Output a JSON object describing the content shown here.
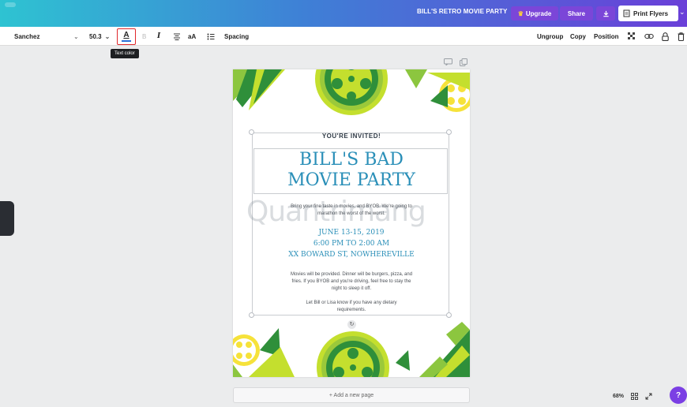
{
  "topbar": {
    "design_title": "BILL'S RETRO MOVIE PARTY",
    "upgrade_label": "Upgrade",
    "share_label": "Share",
    "print_label": "Print Flyers"
  },
  "toolbar": {
    "font_family": "Sanchez",
    "font_size": "50.3",
    "text_color_glyph": "A",
    "italic_glyph": "I",
    "case_glyph": "aA",
    "spacing_label": "Spacing",
    "ungroup_label": "Ungroup",
    "copy_label": "Copy",
    "position_label": "Position",
    "tooltip": "Text color"
  },
  "flyer": {
    "invited": "YOU'RE INVITED!",
    "headline_line1": "BILL'S BAD",
    "headline_line2": "MOVIE PARTY",
    "intro": "Bring your fine taste in movies, and BYOB. We're going to marathon the worst of the worst.",
    "date": "JUNE 13-15, 2019",
    "time": "6:00 PM TO 2:00 AM",
    "address": "XX BOWARD ST, NOWHEREVILLE",
    "details": "Movies will be provided. Dinner will be burgers, pizza, and fries. If you BYOB and you're driving, feel free to stay the night to sleep it off.",
    "contact": "Let Bill or Lisa know if you have any dietary requirements."
  },
  "watermark": "Quantrimang",
  "add_page_label": "+ Add a new page",
  "zoom_level": "68%",
  "help_label": "?",
  "colors": {
    "accent_purple": "#7b46d8",
    "headline_blue": "#2a8fb8",
    "leaf_green": "#7cc242",
    "tooltip_highlight": "#e0282c"
  }
}
